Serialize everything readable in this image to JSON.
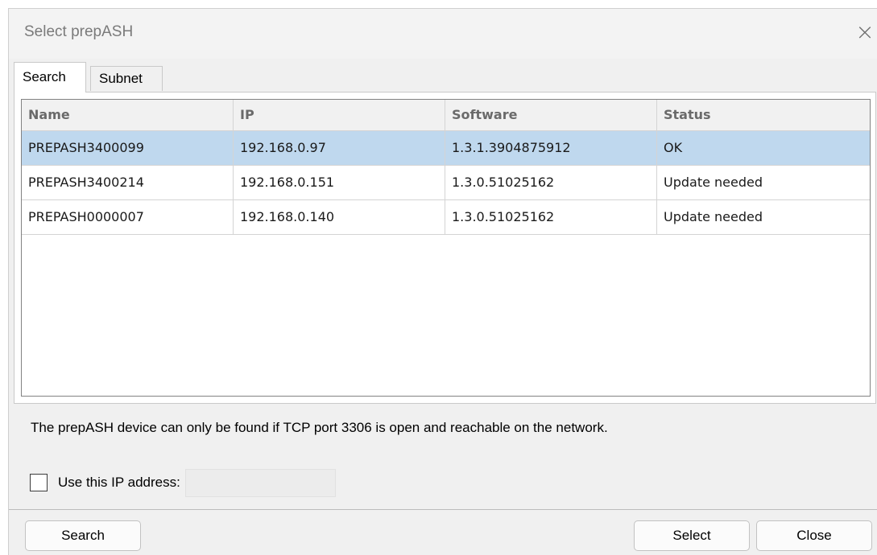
{
  "window": {
    "title": "Select prepASH",
    "close_glyph": "×"
  },
  "tabs": [
    {
      "label": "Search",
      "active": true
    },
    {
      "label": "Subnet",
      "active": false
    }
  ],
  "table": {
    "columns": [
      "Name",
      "IP",
      "Software",
      "Status"
    ],
    "rows": [
      {
        "name": "PREPASH3400099",
        "ip": "192.168.0.97",
        "software": "1.3.1.3904875912",
        "status": "OK",
        "selected": true
      },
      {
        "name": "PREPASH3400214",
        "ip": "192.168.0.151",
        "software": "1.3.0.51025162",
        "status": "Update needed",
        "selected": false
      },
      {
        "name": "PREPASH0000007",
        "ip": "192.168.0.140",
        "software": "1.3.0.51025162",
        "status": "Update needed",
        "selected": false
      }
    ]
  },
  "info_text": "The prepASH device can only be found if TCP port 3306 is open and reachable on the network.",
  "ip_option": {
    "label": "Use this IP address:",
    "checked": false,
    "value": ""
  },
  "buttons": {
    "search": "Search",
    "select": "Select",
    "close": "Close"
  },
  "colors": {
    "selected_row": "#bfd8ee",
    "dialog_bg": "#f0f0f0"
  }
}
